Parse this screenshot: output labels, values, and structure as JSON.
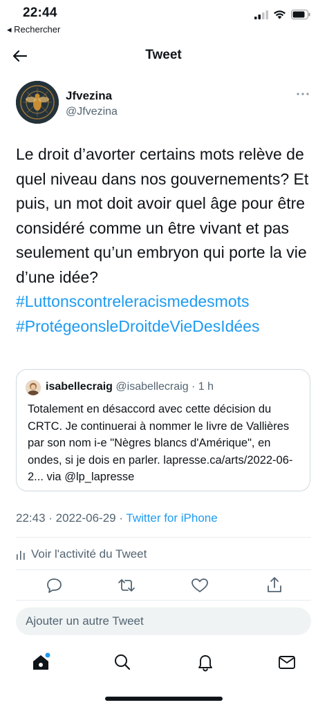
{
  "status_bar": {
    "time": "22:44",
    "back_label": "◂ Rechercher"
  },
  "header": {
    "title": "Tweet"
  },
  "author": {
    "name": "Jfvezina",
    "handle": "@Jfvezina"
  },
  "tweet": {
    "text": "Le droit d’avorter certains mots relève de quel niveau dans nos gouvernements? Et puis, un mot doit avoir quel âge pour être considéré comme un être vivant et pas seulement qu’un embryon qui porte la vie d’une idée?",
    "hashtags": [
      "#Luttonscontreleracismedesmots",
      "#ProtégeonsleDroitdeVieDesIdées"
    ]
  },
  "quote": {
    "name": "isabellecraig",
    "handle_time": "@isabellecraig · 1 h",
    "text": "Totalement en désaccord avec cette décision du CRTC. Je continuerai à nommer le livre de Vallières par son nom i-e \"Nègres blancs d'Amérique\", en ondes,  si je dois en parler. lapresse.ca/arts/2022-06-2... via @lp_lapresse"
  },
  "meta": {
    "timestamp": "22:43 · 2022-06-29 · ",
    "source": "Twitter for iPhone"
  },
  "activity_label": "Voir l'activité du Tweet",
  "actions": [
    "reply-icon",
    "retweet-icon",
    "like-icon",
    "share-icon"
  ],
  "composer_placeholder": "Ajouter un autre Tweet",
  "tabs": [
    "home-icon",
    "search-icon",
    "notifications-icon",
    "messages-icon"
  ],
  "colors": {
    "accent": "#1d9bf0",
    "text": "#0f1419",
    "secondary": "#536471",
    "notification_dot": "#1d9bf0"
  }
}
